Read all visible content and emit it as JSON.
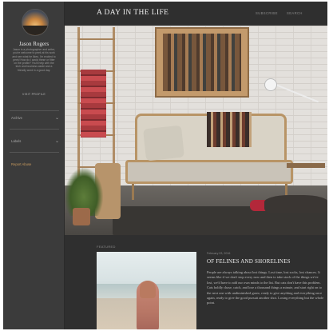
{
  "colors": {
    "sidebar_bg": "#3b3b3b",
    "header_bg": "#2f2f2f",
    "accent_link": "#c89a5e"
  },
  "sidebar": {
    "author_name": "Jason Rogers",
    "author_bio": "Jason is a photographer and writer, you're welcome to peek at his work and see what he likes. I'm excited to peek! How do I avoid these or fitter on the profile? You'll help with the tech and business aside and a friendly word in a good day.",
    "visit_profile": "VISIT PROFILE",
    "menu": [
      {
        "label": "Archive",
        "icon": "chevron-down-icon"
      },
      {
        "label": "Labels",
        "icon": "chevron-down-icon"
      }
    ],
    "report_abuse": "Report Abuse"
  },
  "header": {
    "title": "A DAY IN THE LIFE",
    "links": [
      "SUBSCRIBE",
      "SEARCH"
    ]
  },
  "featured": {
    "label": "FEATURED",
    "date": "February 03, 2016",
    "title": "OF FELINES AND SHORELINES",
    "excerpt": "People are always talking about lost things. Lost time, lost socks, lost chances. It seems like if we don't stop every now and then to take stock of the things we've lost, we'd have to add our own minds to the list. But cats don't have this problem. Cats boldly chase, catch, and lose a thousand things a minute, and start right on to the next one with undiminished gusto, ready to give anything and everything once again, ready to give the good pursuit another shot. Losing everything but the whole point."
  }
}
